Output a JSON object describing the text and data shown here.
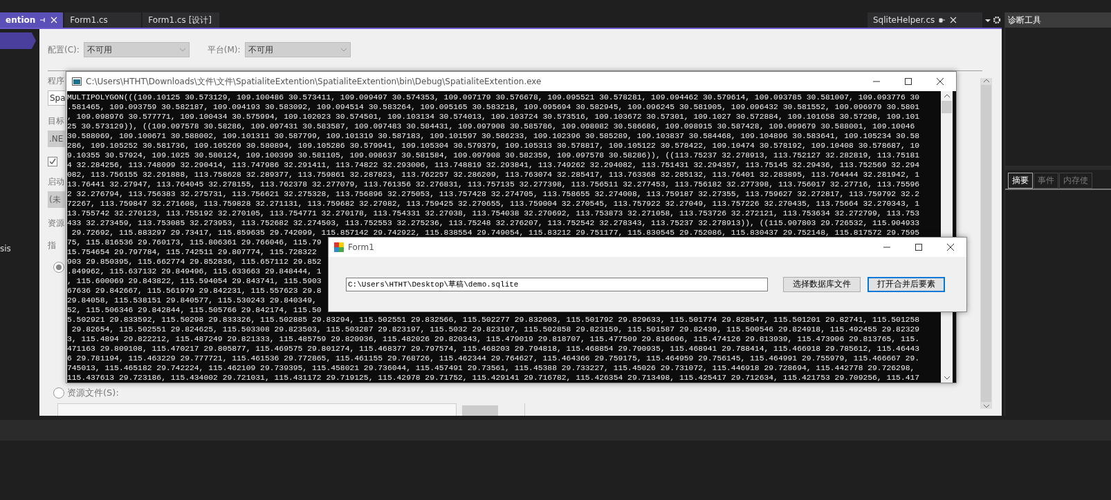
{
  "ide_tabs": [
    {
      "label": "ention",
      "selected": true
    },
    {
      "label": "Form1.cs",
      "selected": false
    },
    {
      "label": "Form1.cs [设计]",
      "selected": false
    }
  ],
  "side_tab": {
    "label": "SqliteHelper.cs"
  },
  "left_panel": {
    "text": "sis"
  },
  "config": [
    {
      "label": "配置(C):",
      "value": "不可用"
    },
    {
      "label": "平台(M):",
      "value": "不可用"
    }
  ],
  "left_items": [
    {
      "kind": "label",
      "text": "程序"
    },
    {
      "kind": "field",
      "text": "Spa"
    },
    {
      "kind": "label",
      "text": "目标"
    },
    {
      "kind": "button",
      "text": ".NE"
    },
    {
      "kind": "checkbox",
      "checked": true
    },
    {
      "kind": "label",
      "text": "启动"
    },
    {
      "kind": "combo",
      "text": "(未"
    },
    {
      "kind": "label",
      "text": "资源"
    },
    {
      "kind": "label",
      "text": "指"
    },
    {
      "kind": "radio",
      "selected": true
    }
  ],
  "resource_radio": {
    "label": "资源文件(S):",
    "selected": false
  },
  "console": {
    "title": "C:\\Users\\HTHT\\Downloads\\文件\\文件\\SpatialiteExtention\\SpatialiteExtention\\bin\\Debug\\SpatialiteExtention.exe",
    "lines": [
      "MULTIPOLYGON(((109.10125 30.573129, 109.100486 30.573411, 109.099497 30.574353, 109.097179 30.576678, 109.095521 30.578281, 109.094462 30.579614, 109.093785 30.581007, 109.093776 30",
      ".581465, 109.093759 30.582187, 109.094193 30.583092, 109.094514 30.583264, 109.095165 30.583218, 109.095694 30.582945, 109.096245 30.581905, 109.096432 30.581552, 109.096979 30.5801",
      ", 109.098976 30.577771, 109.100434 30.575994, 109.102023 30.574501, 109.103134 30.574013, 109.103724 30.573516, 109.103672 30.57301, 109.1027 30.572884, 109.101658 30.57298, 109.101",
      "25 30.573129)), ((109.097578 30.58286, 109.097431 30.583587, 109.097483 30.584431, 109.097908 30.585786, 109.098082 30.586686, 109.098915 30.587428, 109.099679 30.588001, 109.10046",
      "30.588069, 109.100671 30.588002, 109.101311 30.587799, 109.101319 30.587183, 109.101597 30.586233, 109.102396 30.585289, 109.103837 30.584468, 109.104896 30.583641, 109.105234 30.58",
      "286, 109.105252 30.581736, 109.105269 30.580894, 109.105286 30.579941, 109.105304 30.579379, 109.105313 30.578817, 109.105122 30.578422, 109.10474 30.578192, 109.10408 30.578687, 10",
      "9.10355 30.57924, 109.1025 30.580124, 109.100399 30.581105, 109.098637 30.581584, 109.097908 30.582359, 109.097578 30.58286)), ((113.75237 32.278913, 113.752127 32.282819, 113.75181",
      "4 32.284256, 113.748099 32.290414, 113.747986 32.291411, 113.74822 32.293006, 113.748819 32.293841, 113.749262 32.294082, 113.751431 32.294357, 113.75145 32.29436, 113.752569 32.294",
      "082, 113.756155 32.291888, 113.758628 32.289377, 113.759861 32.287823, 113.762257 32.286209, 113.763074 32.285417, 113.763368 32.285132, 113.76401 32.283895, 113.764444 32.281942, 1",
      "13.76441 32.27947, 113.764045 32.278155, 113.762378 32.277079, 113.761356 32.276831, 113.757135 32.277398, 113.756511 32.277453, 113.756182 32.277398, 113.756017 32.27716, 113.75596",
      "2 32.276794, 113.756383 32.275731, 113.756621 32.275328, 113.756896 32.275053, 113.757428 32.274705, 113.758655 32.274008, 113.759187 32.27355, 113.759627 32.272817, 113.759792 32.2",
      "72267, 113.759847 32.271608, 113.759828 32.271131, 113.759682 32.27082, 113.759425 32.270655, 113.759004 32.270545, 113.757922 32.27049, 113.757226 32.270435, 113.75664 32.270343, 1",
      "13.755742 32.270123, 113.755192 32.270105, 113.754771 32.270178, 113.754331 32.27038, 113.754038 32.270692, 113.753873 32.271058, 113.753726 32.272121, 113.753634 32.272799, 113.753",
      "433 32.273459, 113.753085 32.273953, 113.752682 32.274503, 113.752553 32.275236, 113.75248 32.276207, 113.752542 32.278343, 113.75237 32.278913)), ((115.907803 29.726532, 115.904933",
      " 29.72692, 115.883297 29.73417, 115.859635 29.742099, 115.857142 29.742922, 115.838554 29.749054, 115.83212 29.751177, 115.830545 29.752086, 115.830437 29.752148, 115.817572 29.7595",
      "75, 115.816536 29.760173, 115.806361 29.766046, 115.79",
      "15.754654 29.797784, 115.742511 29.807774, 115.728322",
      "903 29.850395, 115.662774 29.852836, 115.657112 29.852",
      ".849962, 115.637132 29.849496, 115.633663 29.848444, 1",
      ", 115.600069 29.843822, 115.594054 29.843741, 115.5903",
      "67636 29.842667, 115.561979 29.842231, 115.557623 29.8",
      "29.84058, 115.538151 29.840577, 115.530243 29.840349,",
      "52, 115.506346 29.842844, 115.505766 29.842174, 115.50",
      "5.502921 29.833592, 115.50298 29.833326, 115.502885 29.83294, 115.502551 29.832566, 115.502277 29.832003, 115.501792 29.829633, 115.501774 29.828547, 115.501201 29.82741, 115.501258",
      " 29.82654, 115.502551 29.824625, 115.503308 29.823503, 115.503287 29.823197, 115.5032 29.823107, 115.502858 29.823159, 115.501587 29.82439, 115.500546 29.824918, 115.492455 29.82329",
      "3, 115.4894 29.822212, 115.487249 29.821333, 115.485759 29.820936, 115.482026 29.820343, 115.479019 29.818707, 115.477509 29.816606, 115.474126 29.813939, 115.473906 29.813765, 115.",
      "471163 29.809108, 115.470217 29.805877, 115.469575 29.801274, 115.468377 29.797574, 115.468203 29.794818, 115.468854 29.790935, 115.468941 29.788414, 115.466918 29.785612, 115.46443",
      "6 29.781194, 115.463229 29.777721, 115.461536 29.772865, 115.461155 29.768726, 115.462344 29.764627, 115.464366 29.759175, 115.464959 29.756145, 115.464991 29.755979, 115.466667 29.",
      "745013, 115.465182 29.742224, 115.462109 29.739395, 115.458021 29.736044, 115.457491 29.73561, 115.45388 29.733227, 115.45026 29.731072, 115.446918 29.728694, 115.442778 29.726298,",
      "115.437613 29.723186, 115.434002 29.721031, 115.431172 29.719125, 115.42978 29.71752, 115.429141 29.716782, 115.426354 29.713498, 115.425417 29.712634, 115.421753 29.709256, 115.417"
    ]
  },
  "form1": {
    "title": "Form1",
    "path_field": {
      "value": "C:\\Users\\HTHT\\Desktop\\草稿\\demo.sqlite"
    },
    "buttons": [
      {
        "label": "选择数据库文件",
        "focused": false
      },
      {
        "label": "打开合并后要素",
        "focused": true
      }
    ]
  },
  "diagnostics": {
    "title": "诊断工具",
    "tabs": [
      {
        "label": "摘要",
        "selected": true
      },
      {
        "label": "事件",
        "selected": false
      },
      {
        "label": "内存使",
        "selected": false
      }
    ]
  }
}
